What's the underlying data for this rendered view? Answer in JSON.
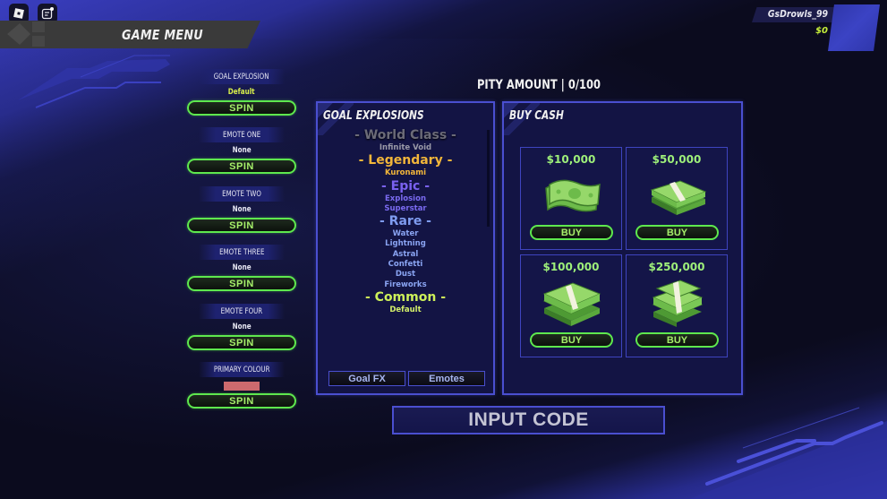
{
  "topbar": {
    "icons": [
      "roblox-menu-icon",
      "chat-icon"
    ],
    "title": "GAME MENU"
  },
  "user": {
    "name": "GsDrowls_99",
    "cash": "$0"
  },
  "slots": [
    {
      "label": "GOAL EXPLOSION",
      "value": "Default",
      "button": "SPIN"
    },
    {
      "label": "EMOTE ONE",
      "value": "None",
      "button": "SPIN"
    },
    {
      "label": "EMOTE TWO",
      "value": "None",
      "button": "SPIN"
    },
    {
      "label": "EMOTE THREE",
      "value": "None",
      "button": "SPIN"
    },
    {
      "label": "EMOTE FOUR",
      "value": "None",
      "button": "SPIN"
    },
    {
      "label": "PRIMARY COLOUR",
      "value_color": "#cc6a6e",
      "button": "SPIN"
    }
  ],
  "pity": "PITY AMOUNT | 0/100",
  "goal_explosions": {
    "title": "GOAL EXPLOSIONS",
    "tiers": [
      {
        "name": "- World Class -",
        "color": "#6b6b78",
        "items": [
          "Infinite Void"
        ],
        "item_color": "#9a9aa8"
      },
      {
        "name": "- Legendary -",
        "color": "#f2b63a",
        "items": [
          "Kuronami"
        ],
        "item_color": "#f2b63a"
      },
      {
        "name": "- Epic -",
        "color": "#7a62f0",
        "items": [
          "Explosion",
          "Superstar"
        ],
        "item_color": "#7a6af0"
      },
      {
        "name": "- Rare -",
        "color": "#7f9cf0",
        "items": [
          "Water",
          "Lightning",
          "Astral",
          "Confetti",
          "Dust",
          "Fireworks"
        ],
        "item_color": "#8aa4f2"
      },
      {
        "name": "- Common -",
        "color": "#cdf05a",
        "items": [
          "Default"
        ],
        "item_color": "#d4f06a"
      }
    ],
    "tabs": [
      "Goal FX",
      "Emotes"
    ]
  },
  "buy_cash": {
    "title": "BUY CASH",
    "offers": [
      {
        "price": "$10,000",
        "icon": "cash-bill-icon",
        "button": "BUY"
      },
      {
        "price": "$50,000",
        "icon": "cash-stack-icon",
        "button": "BUY"
      },
      {
        "price": "$100,000",
        "icon": "cash-stacks-icon",
        "button": "BUY"
      },
      {
        "price": "$250,000",
        "icon": "cash-pile-icon",
        "button": "BUY"
      }
    ]
  },
  "input_code": "INPUT CODE",
  "colors": {
    "accent_green": "#5ee84e",
    "panel_border": "#4a4fd0",
    "background": "#0b0b1e"
  }
}
